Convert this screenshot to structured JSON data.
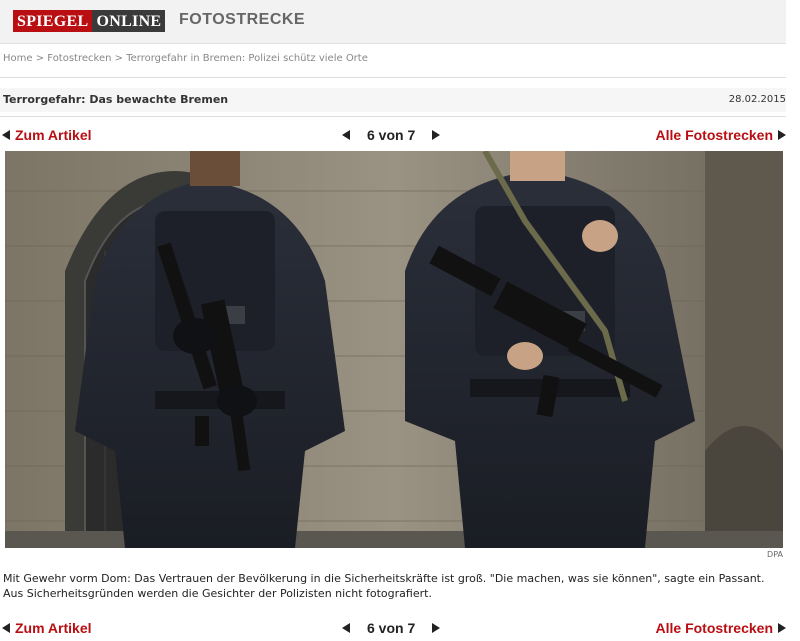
{
  "header": {
    "logo_part1": "SPIEGEL",
    "logo_part2": "ONLINE",
    "section": "FOTOSTRECKE"
  },
  "breadcrumb": {
    "home": "Home",
    "sep": ">",
    "fotostrecken": "Fotostrecken",
    "current": "Terrorgefahr in Bremen: Polizei schütz viele Orte"
  },
  "gallery": {
    "title": "Terrorgefahr: Das bewachte Bremen",
    "date": "28.02.2015"
  },
  "nav": {
    "back_label": "Zum Artikel",
    "counter": "6 von 7",
    "all_label": "Alle Fotostrecken"
  },
  "photo": {
    "credit": "DPA"
  },
  "caption": "Mit Gewehr vorm Dom: Das Vertrauen der Bevölkerung in die Sicherheitskräfte ist groß. \"Die machen, was sie können\", sagte ein Passant. Aus Sicherheitsgründen werden die Gesichter der Polizisten nicht fotografiert.",
  "colors": {
    "brand_red": "#b90e12",
    "header_bg": "#f2f2f2"
  }
}
